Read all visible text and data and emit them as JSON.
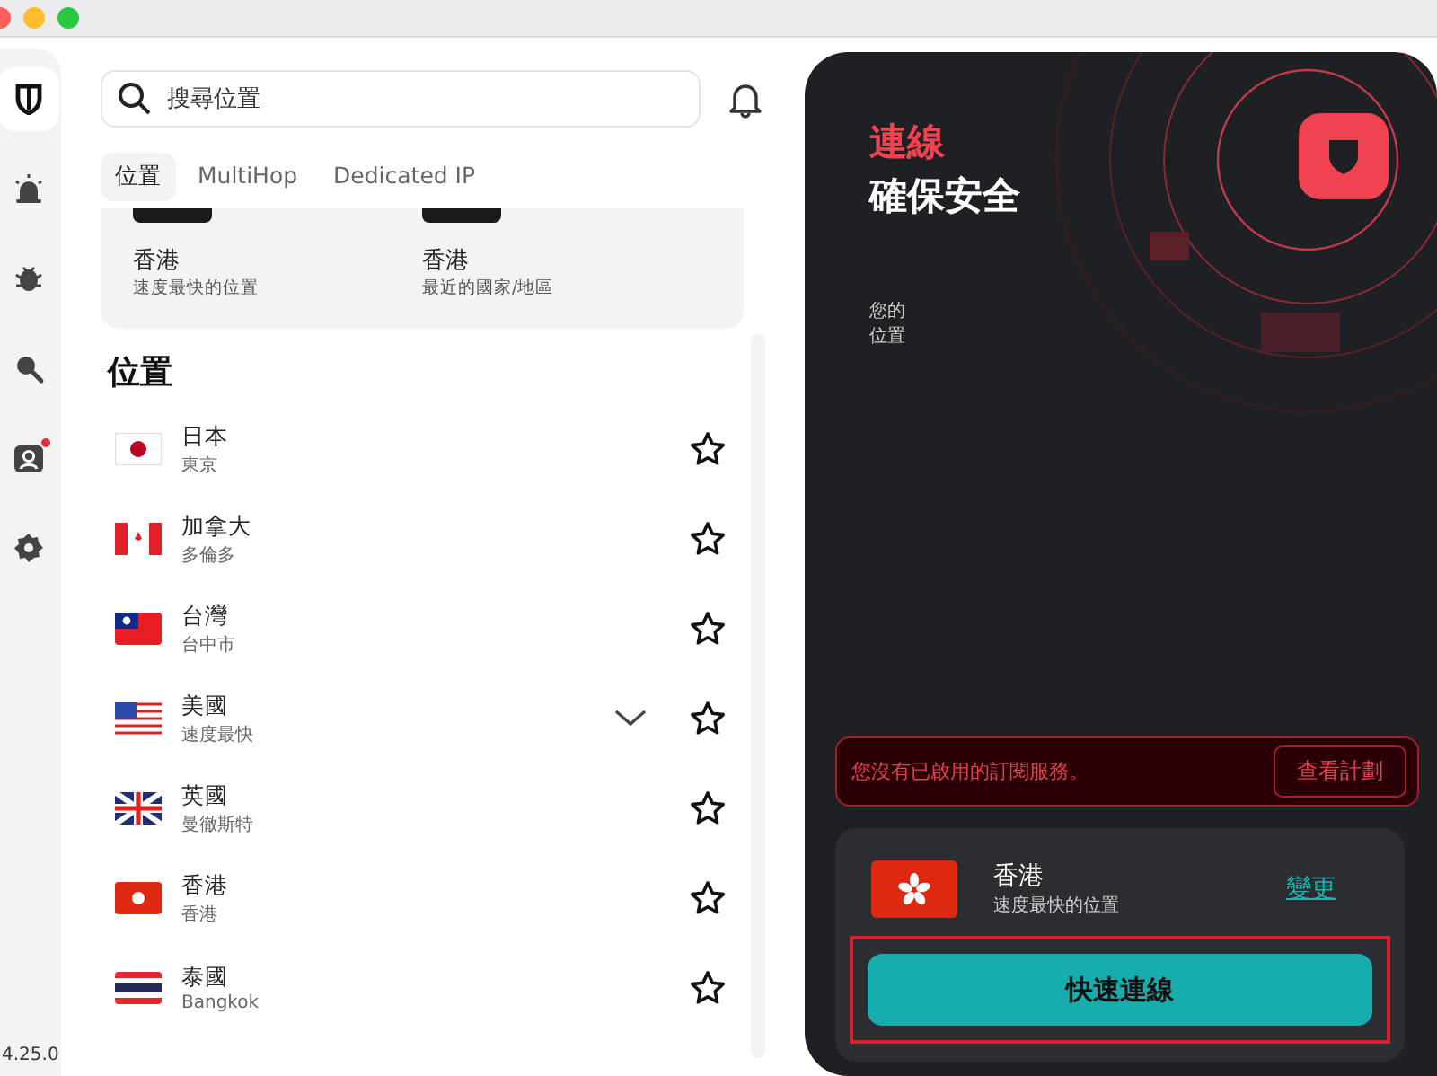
{
  "nav": [
    {
      "kind": "shield",
      "selected": true,
      "badge": false
    },
    {
      "kind": "alarm",
      "selected": false,
      "badge": false
    },
    {
      "kind": "bug",
      "selected": false,
      "badge": false
    },
    {
      "kind": "search",
      "selected": false,
      "badge": false
    },
    {
      "kind": "account",
      "selected": false,
      "badge": true
    },
    {
      "kind": "settings",
      "selected": false,
      "badge": false
    }
  ],
  "version": "4.25.0",
  "search": {
    "placeholder": "搜尋位置"
  },
  "tabs": [
    {
      "label": "位置",
      "selected": true
    },
    {
      "label": "MultiHop",
      "selected": false
    },
    {
      "label": "Dedicated IP",
      "selected": false
    }
  ],
  "quick_cards": [
    {
      "name": "香港",
      "subtitle": "速度最快的位置"
    },
    {
      "name": "香港",
      "subtitle": "最近的國家/地區"
    }
  ],
  "locations_heading": "位置",
  "locations": [
    {
      "kind": "jp",
      "name": "日本",
      "city": "東京",
      "expandable": false
    },
    {
      "kind": "ca",
      "name": "加拿大",
      "city": "多倫多",
      "expandable": false
    },
    {
      "kind": "tw",
      "name": "台灣",
      "city": "台中市",
      "expandable": false
    },
    {
      "kind": "us",
      "name": "美國",
      "city": "速度最快",
      "expandable": true
    },
    {
      "kind": "gb",
      "name": "英國",
      "city": "曼徹斯特",
      "expandable": false
    },
    {
      "kind": "hk",
      "name": "香港",
      "city": "香港",
      "expandable": false
    },
    {
      "kind": "th",
      "name": "泰國",
      "city": "Bangkok",
      "expandable": false
    }
  ],
  "status": {
    "title_accent": "連線",
    "title": "確保安全",
    "location_label": "您的位置"
  },
  "alert": {
    "message": "您沒有已啟用的訂閱服務。",
    "button": "查看計劃"
  },
  "selected_location": {
    "kind": "hk",
    "name": "香港",
    "subtitle": "速度最快的位置",
    "change_link": "變更"
  },
  "connect_button": "快速連線"
}
